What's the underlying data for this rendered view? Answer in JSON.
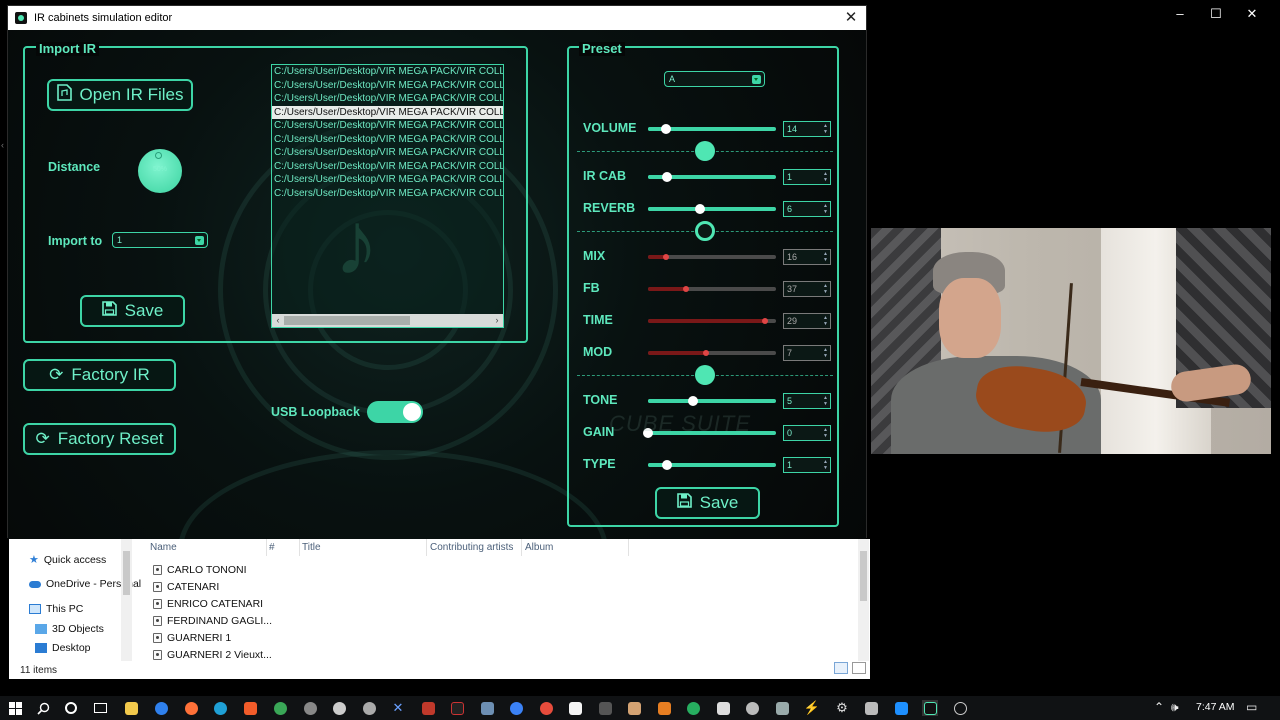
{
  "window": {
    "title": "IR cabinets simulation editor",
    "close": "✕"
  },
  "import_ir": {
    "title": "Import IR",
    "open_button": "Open IR Files",
    "distance_label": "Distance",
    "distance_value": "50%",
    "import_to_label": "Import to",
    "import_to_value": "1",
    "save_button": "Save",
    "files": [
      "C:/Users/User/Desktop/VIR MEGA PACK/VIR COLLECTION",
      "C:/Users/User/Desktop/VIR MEGA PACK/VIR COLLECTION",
      "C:/Users/User/Desktop/VIR MEGA PACK/VIR COLLECTION",
      "C:/Users/User/Desktop/VIR MEGA PACK/VIR COLLECTION",
      "C:/Users/User/Desktop/VIR MEGA PACK/VIR COLLECTION",
      "C:/Users/User/Desktop/VIR MEGA PACK/VIR COLLECTION",
      "C:/Users/User/Desktop/VIR MEGA PACK/VIR COLLECTION",
      "C:/Users/User/Desktop/VIR MEGA PACK/VIR COLLECTION",
      "C:/Users/User/Desktop/VIR MEGA PACK/VIR COLLECTION",
      "C:/Users/User/Desktop/VIR MEGA PACK/VIR COLLECTION"
    ],
    "selected_index": 3
  },
  "factory_ir_button": "Factory IR",
  "factory_reset_button": "Factory Reset",
  "usb_loopback": {
    "label": "USB Loopback",
    "on": true
  },
  "preset": {
    "title": "Preset",
    "selected": "A",
    "save_button": "Save",
    "watermark": "CUBE SUITE",
    "sliders": [
      {
        "name": "VOLUME",
        "value": "14",
        "level": 0.14,
        "color": "#3dd5a6"
      },
      {
        "name": "IR CAB",
        "value": "1",
        "level": 0.15,
        "color": "#3dd5a6"
      },
      {
        "name": "REVERB",
        "value": "6",
        "level": 0.41,
        "color": "#3dd5a6"
      },
      {
        "name": "MIX",
        "value": "16",
        "level": 0.16,
        "color": "#8a1c1c"
      },
      {
        "name": "FB",
        "value": "37",
        "level": 0.31,
        "color": "#8a1c1c"
      },
      {
        "name": "TIME",
        "value": "29",
        "level": 0.93,
        "color": "#8a1c1c"
      },
      {
        "name": "MOD",
        "value": "7",
        "level": 0.47,
        "color": "#8a1c1c"
      },
      {
        "name": "TONE",
        "value": "5",
        "level": 0.35,
        "color": "#3dd5a6"
      },
      {
        "name": "GAIN",
        "value": "0",
        "level": 0.0,
        "color": "#3dd5a6"
      },
      {
        "name": "TYPE",
        "value": "1",
        "level": 0.15,
        "color": "#3dd5a6"
      }
    ]
  },
  "explorer": {
    "nav": [
      "Quick access",
      "OneDrive - Personal",
      "This PC",
      "3D Objects",
      "Desktop"
    ],
    "columns": [
      "Name",
      "#",
      "Title",
      "Contributing artists",
      "Album"
    ],
    "files": [
      "CARLO TONONI",
      "CATENARI",
      "ENRICO CATENARI",
      "FERDINAND GAGLI...",
      "GUARNERI 1",
      "GUARNERI 2 Vieuxt..."
    ],
    "status": "11 items"
  },
  "taskbar": {
    "time": "7:47 AM"
  }
}
